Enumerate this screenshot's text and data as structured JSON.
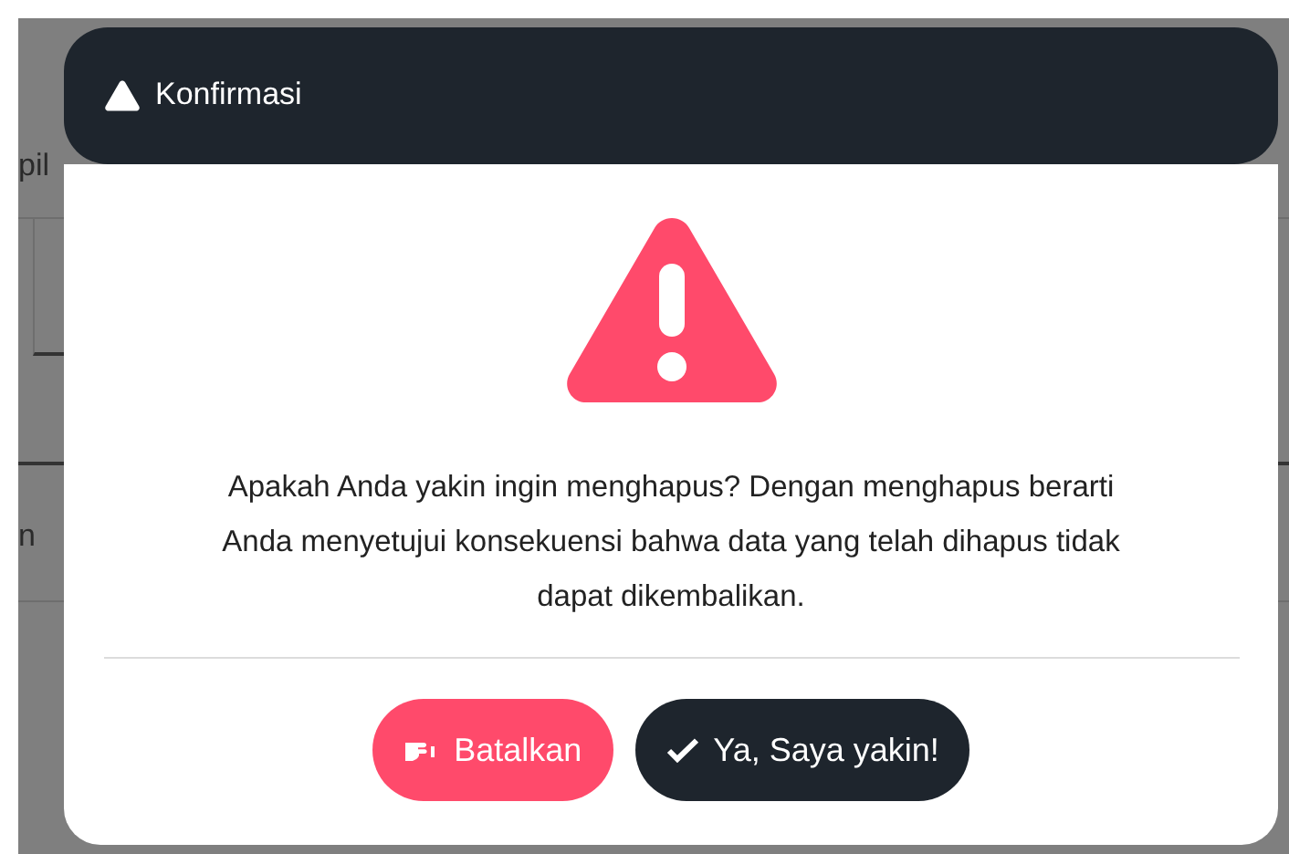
{
  "background": {
    "fragments": [
      "pil",
      "n"
    ]
  },
  "dialog": {
    "title": "Konfirmasi",
    "message": "Apakah Anda yakin ingin menghapus? Dengan menghapus berarti Anda menyetujui konsekuensi bahwa data yang telah dihapus tidak dapat dikembalikan.",
    "buttons": [
      {
        "label": "Batalkan",
        "kind": "cancel"
      },
      {
        "label": "Ya, Saya yakin!",
        "kind": "confirm"
      }
    ]
  }
}
